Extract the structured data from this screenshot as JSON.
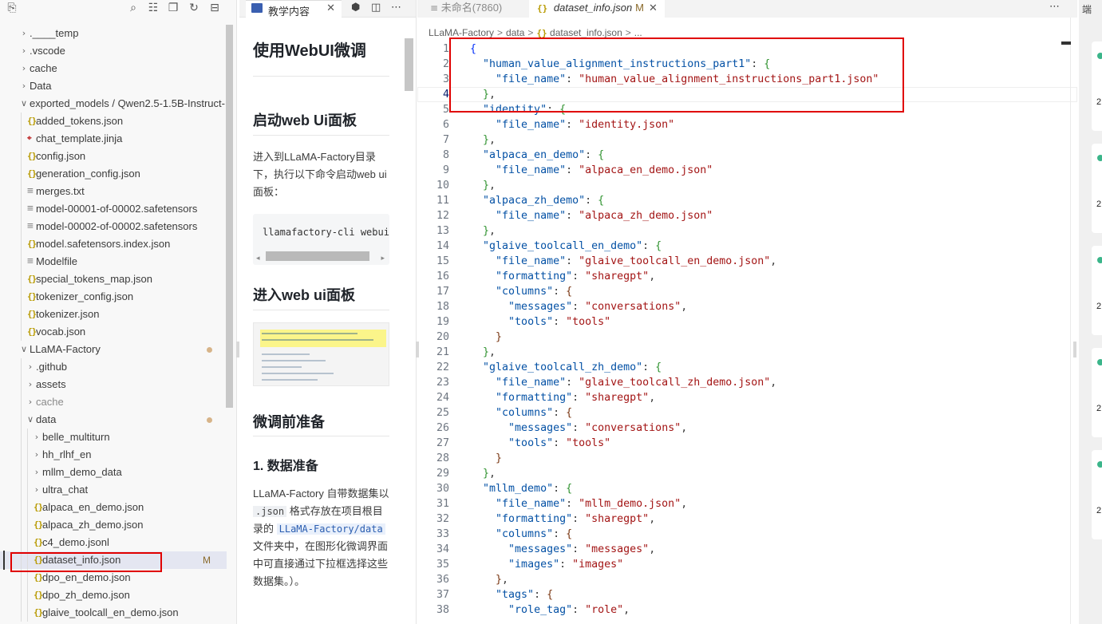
{
  "explorer": {
    "tree": [
      {
        "label": ".____temp",
        "depth": 0,
        "type": "folder",
        "open": false
      },
      {
        "label": ".vscode",
        "depth": 0,
        "type": "folder",
        "open": false
      },
      {
        "label": "cache",
        "depth": 0,
        "type": "folder",
        "open": false
      },
      {
        "label": "Data",
        "depth": 0,
        "type": "folder",
        "open": false
      },
      {
        "label": "exported_models / Qwen2.5-1.5B-Instruct-...",
        "depth": 0,
        "type": "folder",
        "open": true
      },
      {
        "label": "added_tokens.json",
        "depth": 1,
        "type": "json"
      },
      {
        "label": "chat_template.jinja",
        "depth": 1,
        "type": "jinja"
      },
      {
        "label": "config.json",
        "depth": 1,
        "type": "json"
      },
      {
        "label": "generation_config.json",
        "depth": 1,
        "type": "json"
      },
      {
        "label": "merges.txt",
        "depth": 1,
        "type": "plain"
      },
      {
        "label": "model-00001-of-00002.safetensors",
        "depth": 1,
        "type": "plain"
      },
      {
        "label": "model-00002-of-00002.safetensors",
        "depth": 1,
        "type": "plain"
      },
      {
        "label": "model.safetensors.index.json",
        "depth": 1,
        "type": "json"
      },
      {
        "label": "Modelfile",
        "depth": 1,
        "type": "plain"
      },
      {
        "label": "special_tokens_map.json",
        "depth": 1,
        "type": "json"
      },
      {
        "label": "tokenizer_config.json",
        "depth": 1,
        "type": "json"
      },
      {
        "label": "tokenizer.json",
        "depth": 1,
        "type": "json"
      },
      {
        "label": "vocab.json",
        "depth": 1,
        "type": "json"
      },
      {
        "label": "LLaMA-Factory",
        "depth": 0,
        "type": "folder",
        "open": true,
        "dot": true
      },
      {
        "label": ".github",
        "depth": 1,
        "type": "folder",
        "open": false
      },
      {
        "label": "assets",
        "depth": 1,
        "type": "folder",
        "open": false
      },
      {
        "label": "cache",
        "depth": 1,
        "type": "folder",
        "open": false,
        "dim": true
      },
      {
        "label": "data",
        "depth": 1,
        "type": "folder",
        "open": true,
        "dot": true
      },
      {
        "label": "belle_multiturn",
        "depth": 2,
        "type": "folder",
        "open": false
      },
      {
        "label": "hh_rlhf_en",
        "depth": 2,
        "type": "folder",
        "open": false
      },
      {
        "label": "mllm_demo_data",
        "depth": 2,
        "type": "folder",
        "open": false
      },
      {
        "label": "ultra_chat",
        "depth": 2,
        "type": "folder",
        "open": false
      },
      {
        "label": "alpaca_en_demo.json",
        "depth": 2,
        "type": "json"
      },
      {
        "label": "alpaca_zh_demo.json",
        "depth": 2,
        "type": "json"
      },
      {
        "label": "c4_demo.jsonl",
        "depth": 2,
        "type": "json"
      },
      {
        "label": "dataset_info.json",
        "depth": 2,
        "type": "json",
        "selected": true,
        "modified": "M"
      },
      {
        "label": "dpo_en_demo.json",
        "depth": 2,
        "type": "json"
      },
      {
        "label": "dpo_zh_demo.json",
        "depth": 2,
        "type": "json"
      },
      {
        "label": "glaive_toolcall_en_demo.json",
        "depth": 2,
        "type": "json"
      }
    ]
  },
  "doc": {
    "tab_label": "教学内容",
    "title": "使用WebUI微调",
    "section1": "启动web Ui面板",
    "para1": "进入到LLaMA-Factory目录下，执行以下命令启动web ui面板：",
    "code": "llamafactory-cli webui",
    "section2": "进入web ui面板",
    "section3": "微调前准备",
    "subsection": "1. 数据准备",
    "para2_a": "LLaMA-Factory 自带数据集以 ",
    "para2_code1": ".json",
    "para2_b": " 格式存放在项目根目录的 ",
    "para2_code2": "LLaMA-Factory/data",
    "para2_c": " 文件夹中，在图形化微调界面中可直接通过下拉框选择这些数据集。）。"
  },
  "editor": {
    "tabs": [
      {
        "label": "未命名(7860)"
      },
      {
        "label": "dataset_info.json",
        "flag": "M"
      }
    ],
    "breadcrumb": [
      "LLaMA-Factory",
      "data",
      "dataset_info.json",
      "..."
    ],
    "current_line": 4,
    "lines": [
      "{",
      "  \"human_value_alignment_instructions_part1\": {",
      "    \"file_name\": \"human_value_alignment_instructions_part1.json\"",
      "  },",
      "  \"identity\": {",
      "    \"file_name\": \"identity.json\"",
      "  },",
      "  \"alpaca_en_demo\": {",
      "    \"file_name\": \"alpaca_en_demo.json\"",
      "  },",
      "  \"alpaca_zh_demo\": {",
      "    \"file_name\": \"alpaca_zh_demo.json\"",
      "  },",
      "  \"glaive_toolcall_en_demo\": {",
      "    \"file_name\": \"glaive_toolcall_en_demo.json\",",
      "    \"formatting\": \"sharegpt\",",
      "    \"columns\": {",
      "      \"messages\": \"conversations\",",
      "      \"tools\": \"tools\"",
      "    }",
      "  },",
      "  \"glaive_toolcall_zh_demo\": {",
      "    \"file_name\": \"glaive_toolcall_zh_demo.json\",",
      "    \"formatting\": \"sharegpt\",",
      "    \"columns\": {",
      "      \"messages\": \"conversations\",",
      "      \"tools\": \"tools\"",
      "    }",
      "  },",
      "  \"mllm_demo\": {",
      "    \"file_name\": \"mllm_demo.json\",",
      "    \"formatting\": \"sharegpt\",",
      "    \"columns\": {",
      "      \"messages\": \"messages\",",
      "      \"images\": \"images\"",
      "    },",
      "    \"tags\": {",
      "      \"role_tag\": \"role\","
    ]
  },
  "right_panel": {
    "title": "端",
    "cards": [
      "2",
      "2",
      "2",
      "2",
      "2"
    ]
  },
  "colors": {
    "highlight_box": "#e00000",
    "json_key": "#0451a5",
    "json_string": "#a31515",
    "selection": "#e4e6f1"
  }
}
